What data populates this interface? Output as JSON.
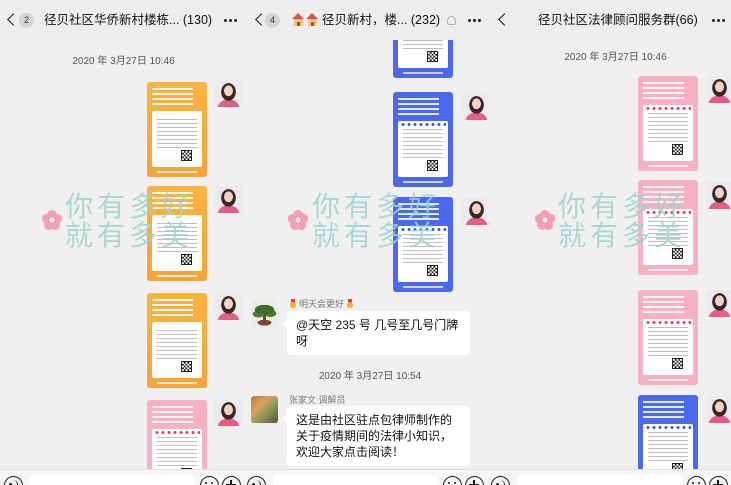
{
  "theme": {
    "chat_bg": "#f0f0f0",
    "header_bg": "#ededed",
    "bubble_bg": "#ffffff",
    "orange": "#f8a23a",
    "blue": "#4a68f0",
    "pink": "#f6b1c3",
    "watermark": "#9fd3cb"
  },
  "icons": {
    "back": "chevron-left-icon",
    "more": "more-dots-icon",
    "group": "house-icon",
    "mute": "mute-icon",
    "medal": "medal-icon",
    "voice": "voice-icon",
    "emoji": "emoji-icon",
    "plus": "plus-icon",
    "watermark_flower": "flower-icon"
  },
  "watermark": {
    "line1": "你有多好",
    "line2": "就有多美"
  },
  "panels": [
    {
      "header": {
        "badge": "2",
        "title": "径贝社区华侨新村楼栋... (130)"
      },
      "timestamps": [
        "2020 年 3月27日 10:46"
      ]
    },
    {
      "header": {
        "badge": "4",
        "title": "径贝新村，楼... (232)"
      },
      "timestamps": [
        "2020 年 3月27日 10:54"
      ],
      "messages": [
        {
          "sender": "明天会更好",
          "text": "@天空 235 号 几号至几号门牌呀"
        },
        {
          "sender": "张家文 调解员",
          "text": "这是由社区驻点包律师制作的关于疫情期间的法律小知识，欢迎大家点击阅读！"
        }
      ]
    },
    {
      "header": {
        "title": "径贝社区法律顾问服务群(66)"
      },
      "timestamps": [
        "2020 年 3月27日 10:46"
      ]
    }
  ]
}
